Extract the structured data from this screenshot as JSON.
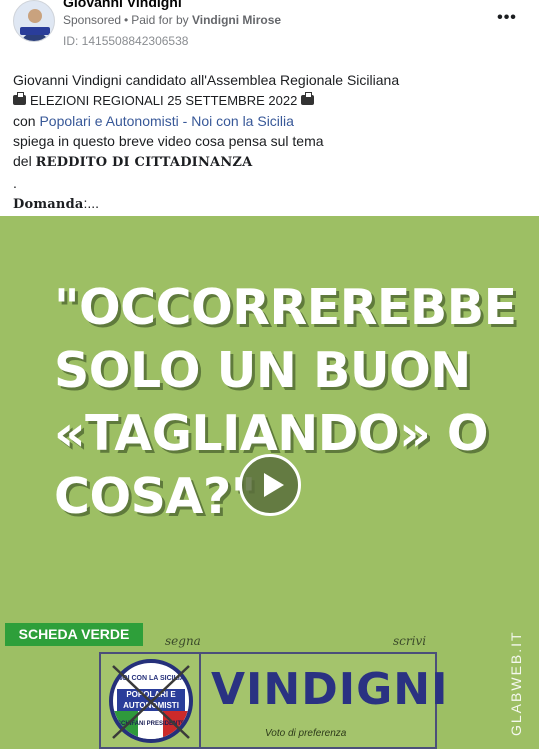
{
  "header": {
    "page_name": "Giovanni Vindigni",
    "sponsored_label": "Sponsored",
    "paid_for_label": "Paid for by",
    "paid_for_name": "Vindigni Mirose",
    "ad_id": "ID: 1415508842306538",
    "more_icon": "more-options-icon"
  },
  "post": {
    "line1": "Giovanni Vindigni candidato all'Assemblea Regionale Siciliana",
    "line2": "ELEZIONI REGIONALI 25 SETTEMBRE 2022",
    "line3_prefix": "con",
    "line3_link": "Popolari e Autonomisti - Noi con la Sicilia",
    "line4": "spiega in questo breve video cosa pensa sul tema",
    "line5_prefix": "del",
    "line5_bold": "REDDITO DI CITTADINANZA",
    "line6": ".",
    "line7_bold": "Domanda",
    "line7_rest": ":..."
  },
  "video": {
    "quote_line1": "\"OCCORREREBBE",
    "quote_line2": "SOLO UN BUON",
    "quote_line3": "«TAGLIANDO» O",
    "quote_line4": "COSA?\"",
    "play_icon": "play-icon",
    "scheda_label": "SCHEDA VERDE",
    "segna_label": "segna",
    "scrivi_label": "scrivi",
    "logo_top": "NOI CON LA SICILIA",
    "logo_mid": "POPOLARI E AUTONOMISTI",
    "logo_sub": "SCHIFANI PRESIDENTE",
    "candidate_name": "VINDIGNI",
    "preference_label": "Voto di preferenza",
    "watermark": "GLABWEB.IT",
    "colors": {
      "background": "#9dbf64",
      "scheda": "#2e9f3a",
      "name": "#2a3282"
    }
  }
}
